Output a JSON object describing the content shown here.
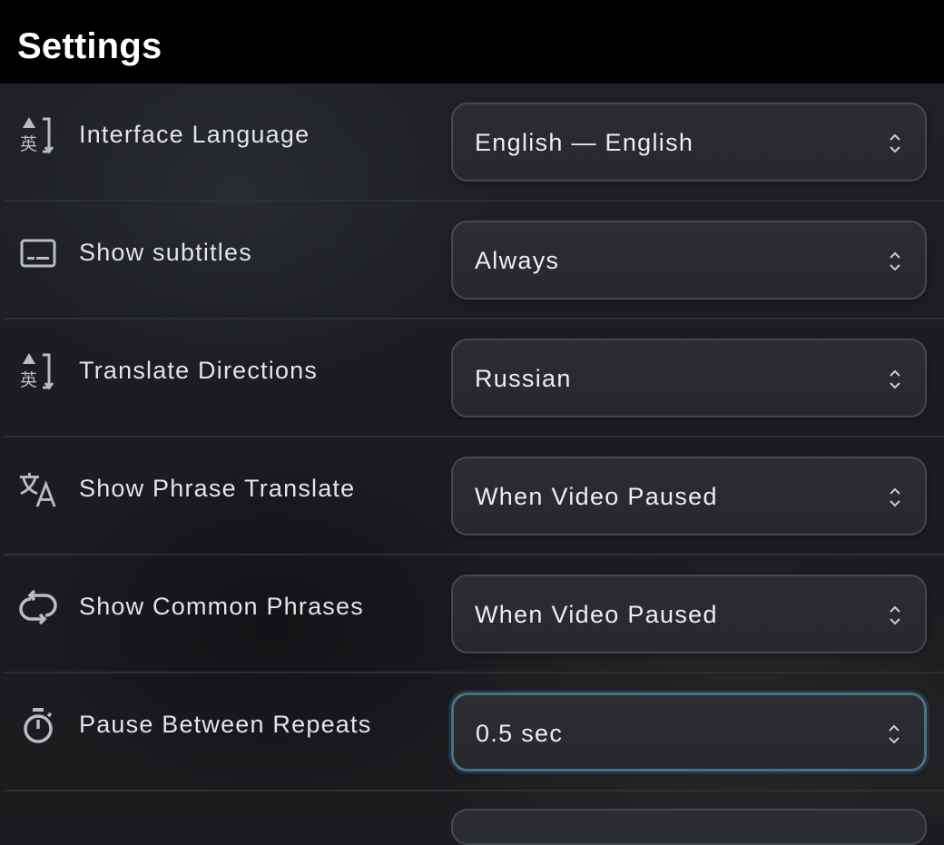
{
  "header": {
    "title": "Settings"
  },
  "rows": [
    {
      "icon": "translate-direction-icon",
      "label": "Interface Language",
      "value": "English — English"
    },
    {
      "icon": "subtitles-icon",
      "label": "Show subtitles",
      "value": "Always"
    },
    {
      "icon": "translate-direction-icon",
      "label": "Translate Directions",
      "value": "Russian"
    },
    {
      "icon": "translate-icon",
      "label": "Show Phrase Translate",
      "value": "When Video Paused"
    },
    {
      "icon": "repeat-icon",
      "label": "Show Common Phrases",
      "value": "When Video Paused"
    },
    {
      "icon": "timer-icon",
      "label": "Pause Between Repeats",
      "value": "0.5 sec",
      "focused": true
    }
  ],
  "colors": {
    "header_bg": "#000000",
    "focus_ring": "#4d6f84"
  }
}
